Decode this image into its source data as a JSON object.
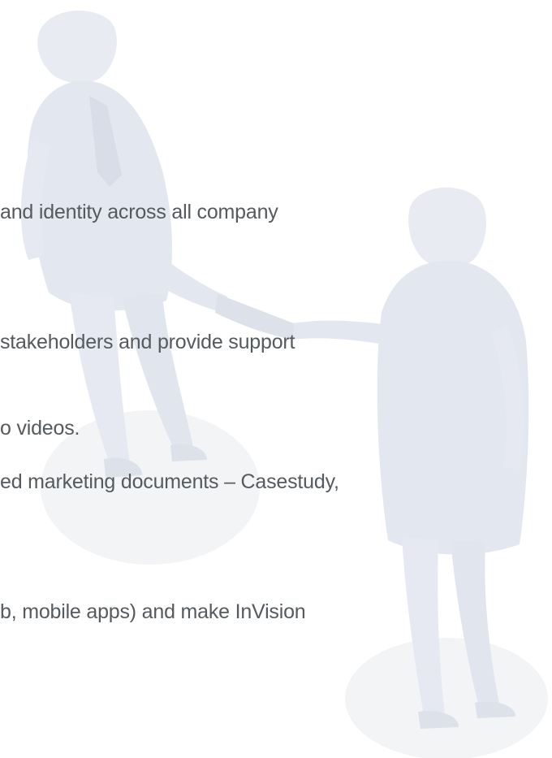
{
  "content": {
    "lines": [
      " and identity across all company",
      "stakeholders and provide support",
      "o videos.",
      "ed marketing documents – Casestudy,",
      "b, mobile apps) and make InVision"
    ]
  },
  "colors": {
    "text": "#555a5e",
    "illustration": "#e6e9f1",
    "illustration_dark": "#dde1ea",
    "shadow": "#f0f1f4"
  },
  "illustration": {
    "icon": "business-handshake-illustration"
  }
}
